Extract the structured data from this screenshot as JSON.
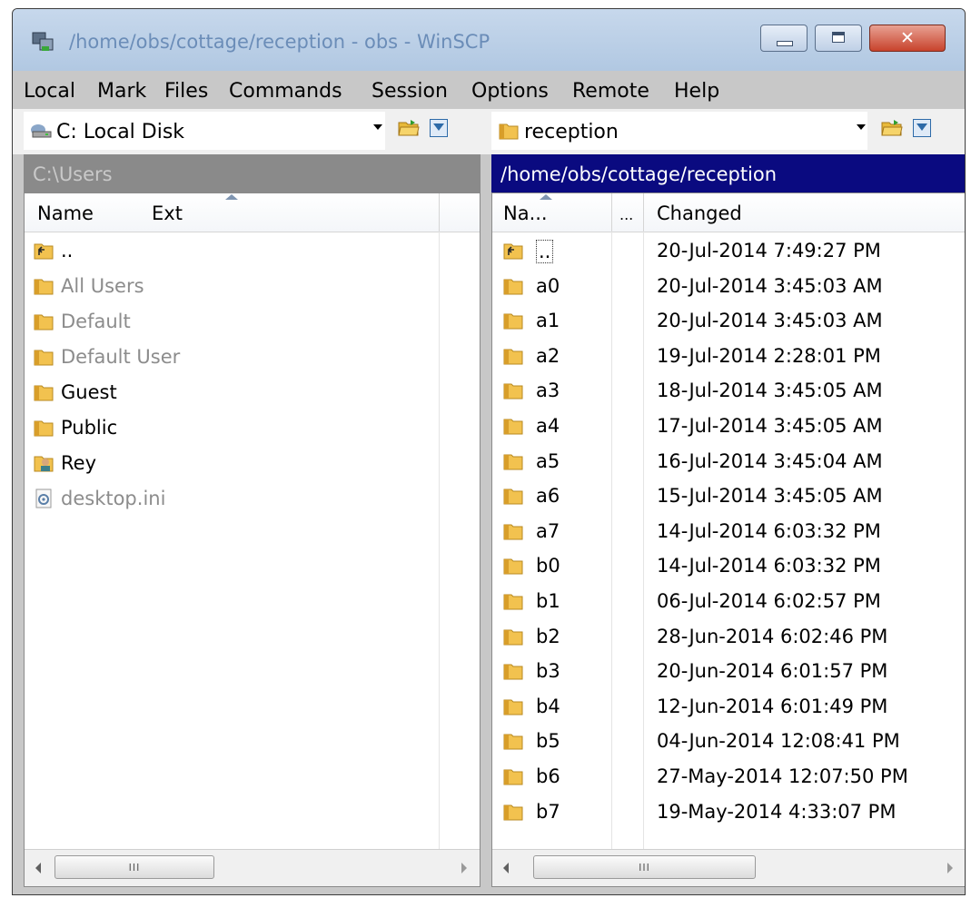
{
  "window": {
    "title": "/home/obs/cottage/reception - obs - WinSCP",
    "close_glyph": "✕"
  },
  "menu": [
    "Local",
    "Mark",
    "Files",
    "Commands",
    "Session",
    "Options",
    "Remote",
    "Help"
  ],
  "local": {
    "drive_label": "C: Local Disk",
    "path": "C:\\Users",
    "columns": {
      "name": "Name",
      "ext": "Ext"
    },
    "items": [
      {
        "name": "..",
        "icon": "parent-folder-icon",
        "dimmed": false
      },
      {
        "name": "All Users",
        "icon": "folder-icon",
        "dimmed": true
      },
      {
        "name": "Default",
        "icon": "folder-icon",
        "dimmed": true
      },
      {
        "name": "Default User",
        "icon": "folder-icon",
        "dimmed": true
      },
      {
        "name": "Guest",
        "icon": "folder-icon",
        "dimmed": false
      },
      {
        "name": "Public",
        "icon": "folder-icon",
        "dimmed": false
      },
      {
        "name": "Rey",
        "icon": "user-folder-icon",
        "dimmed": false
      },
      {
        "name": "desktop.ini",
        "icon": "settings-file-icon",
        "dimmed": true
      }
    ]
  },
  "remote": {
    "folder_label": "reception",
    "path": "/home/obs/cottage/reception",
    "columns": {
      "name": "Na...",
      "size": "...",
      "changed": "Changed"
    },
    "items": [
      {
        "name": "..",
        "changed": "20-Jul-2014 7:49:27 PM",
        "icon": "parent-folder-icon"
      },
      {
        "name": "a0",
        "changed": "20-Jul-2014 3:45:03 AM",
        "icon": "folder-icon"
      },
      {
        "name": "a1",
        "changed": "20-Jul-2014 3:45:03 AM",
        "icon": "folder-icon"
      },
      {
        "name": "a2",
        "changed": "19-Jul-2014 2:28:01 PM",
        "icon": "folder-icon"
      },
      {
        "name": "a3",
        "changed": "18-Jul-2014 3:45:05 AM",
        "icon": "folder-icon"
      },
      {
        "name": "a4",
        "changed": "17-Jul-2014 3:45:05 AM",
        "icon": "folder-icon"
      },
      {
        "name": "a5",
        "changed": "16-Jul-2014 3:45:04 AM",
        "icon": "folder-icon"
      },
      {
        "name": "a6",
        "changed": "15-Jul-2014 3:45:05 AM",
        "icon": "folder-icon"
      },
      {
        "name": "a7",
        "changed": "14-Jul-2014 6:03:32 PM",
        "icon": "folder-icon"
      },
      {
        "name": "b0",
        "changed": "14-Jul-2014 6:03:32 PM",
        "icon": "folder-icon"
      },
      {
        "name": "b1",
        "changed": "06-Jul-2014 6:02:57 PM",
        "icon": "folder-icon"
      },
      {
        "name": "b2",
        "changed": "28-Jun-2014 6:02:46 PM",
        "icon": "folder-icon"
      },
      {
        "name": "b3",
        "changed": "20-Jun-2014 6:01:57 PM",
        "icon": "folder-icon"
      },
      {
        "name": "b4",
        "changed": "12-Jun-2014 6:01:49 PM",
        "icon": "folder-icon"
      },
      {
        "name": "b5",
        "changed": "04-Jun-2014 12:08:41 PM",
        "icon": "folder-icon"
      },
      {
        "name": "b6",
        "changed": "27-May-2014 12:07:50 PM",
        "icon": "folder-icon"
      },
      {
        "name": "b7",
        "changed": "19-May-2014 4:33:07 PM",
        "icon": "folder-icon"
      }
    ]
  },
  "scrollbar": {
    "grip": "III"
  },
  "colors": {
    "active_path_bg": "#0a0a80",
    "inactive_path_bg": "#8a8a8a",
    "folder_yellow": "#f2c24f",
    "title_text": "#6b8db8"
  }
}
